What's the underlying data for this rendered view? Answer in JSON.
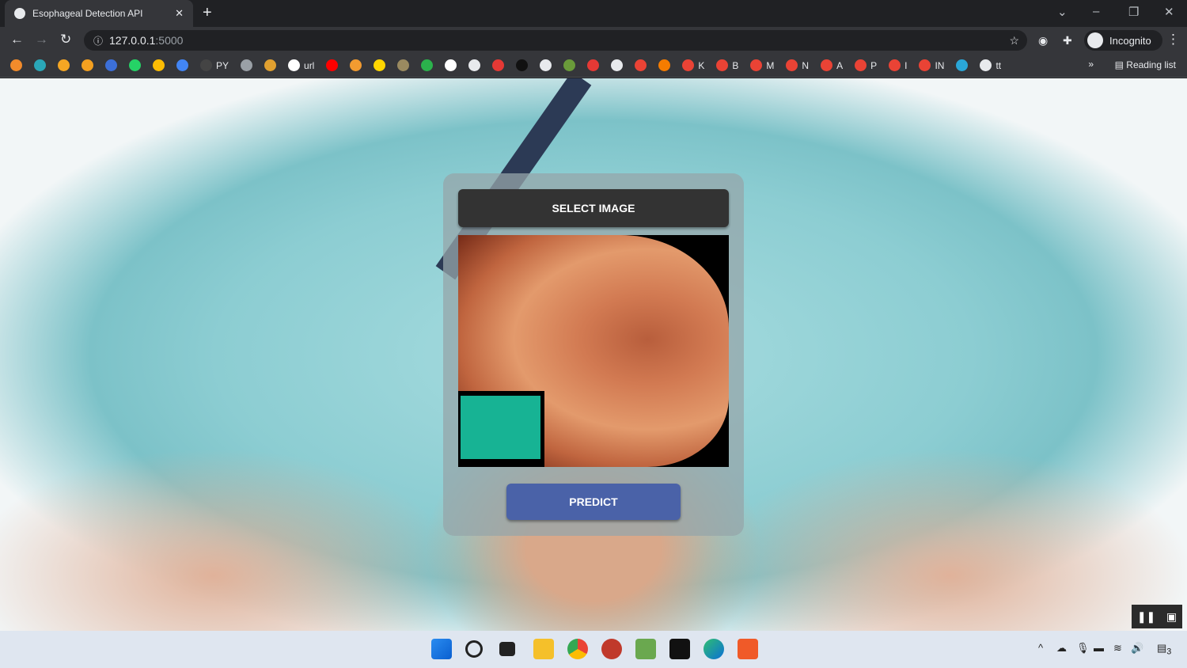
{
  "browser": {
    "tab_title": "Esophageal Detection API",
    "url_host": "127.0.0.1",
    "url_port": ":5000",
    "profile": "Incognito",
    "reading_list": "Reading list",
    "more": "»"
  },
  "bookmarks": [
    {
      "label": "",
      "color": "#f28b2b"
    },
    {
      "label": "",
      "color": "#2aa7b8"
    },
    {
      "label": "",
      "color": "#f5a623"
    },
    {
      "label": "",
      "color": "#f4a020"
    },
    {
      "label": "",
      "color": "#3c6fd8"
    },
    {
      "label": "",
      "color": "#25d366"
    },
    {
      "label": "",
      "color": "#fbbc04"
    },
    {
      "label": "",
      "color": "#4285f4"
    },
    {
      "label": "PY",
      "color": "#444"
    },
    {
      "label": "",
      "color": "#9aa0a6"
    },
    {
      "label": "",
      "color": "#e0a030"
    },
    {
      "label": "url",
      "color": "#ffffff"
    },
    {
      "label": "",
      "color": "#ff0000"
    },
    {
      "label": "",
      "color": "#f29b30"
    },
    {
      "label": "",
      "color": "#ffd600"
    },
    {
      "label": "",
      "color": "#9a8a60"
    },
    {
      "label": "",
      "color": "#2bb24c"
    },
    {
      "label": "",
      "color": "#ffffff"
    },
    {
      "label": "",
      "color": "#e8eaed"
    },
    {
      "label": "",
      "color": "#e53935"
    },
    {
      "label": "",
      "color": "#111"
    },
    {
      "label": "",
      "color": "#e8eaed"
    },
    {
      "label": "",
      "color": "#6a9b3a"
    },
    {
      "label": "",
      "color": "#e53935"
    },
    {
      "label": "",
      "color": "#e8eaed"
    },
    {
      "label": "",
      "color": "#ea4335"
    },
    {
      "label": "",
      "color": "#f57c00"
    },
    {
      "label": "K",
      "color": "#ea4335"
    },
    {
      "label": "B",
      "color": "#ea4335"
    },
    {
      "label": "M",
      "color": "#ea4335"
    },
    {
      "label": "N",
      "color": "#ea4335"
    },
    {
      "label": "A",
      "color": "#ea4335"
    },
    {
      "label": "P",
      "color": "#ea4335"
    },
    {
      "label": "I",
      "color": "#ea4335"
    },
    {
      "label": "IN",
      "color": "#ea4335"
    },
    {
      "label": "",
      "color": "#2aa7d8"
    },
    {
      "label": "tt",
      "color": "#e8eaed"
    }
  ],
  "app": {
    "select_label": "SELECT IMAGE",
    "predict_label": "PREDICT"
  },
  "taskbar": {
    "icons": [
      "windows-start",
      "search",
      "task-view",
      "file-explorer",
      "chrome",
      "app",
      "paint",
      "terminal",
      "edge",
      "sublime"
    ],
    "notification_count": "3"
  }
}
